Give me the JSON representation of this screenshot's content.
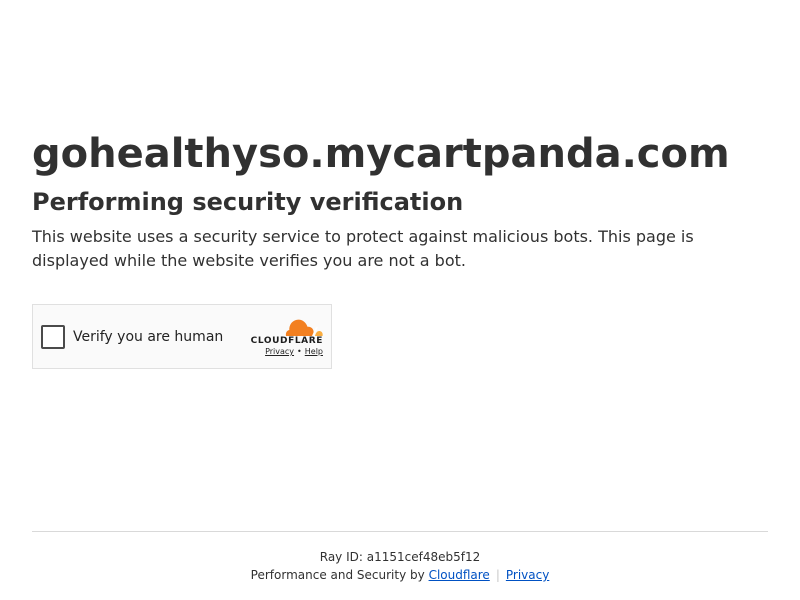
{
  "site": {
    "domain": "gohealthyso.mycartpanda.com",
    "heading": "Performing security verification",
    "description": "This website uses a security service to protect against malicious bots. This page is displayed while the website verifies you are not a bot."
  },
  "widget": {
    "checkbox_label": "Verify you are human",
    "checked": false,
    "brand": "CLOUDFLARE",
    "privacy_link": "Privacy",
    "separator": "•",
    "help_link": "Help",
    "brand_color": "#f38020"
  },
  "footer": {
    "ray_label": "Ray ID:",
    "ray_id": "a1151cef48eb5f12",
    "performance_text": "Performance and Security by",
    "cloudflare_link": "Cloudflare",
    "divider": "|",
    "privacy_link": "Privacy",
    "link_color": "#0051c3"
  }
}
